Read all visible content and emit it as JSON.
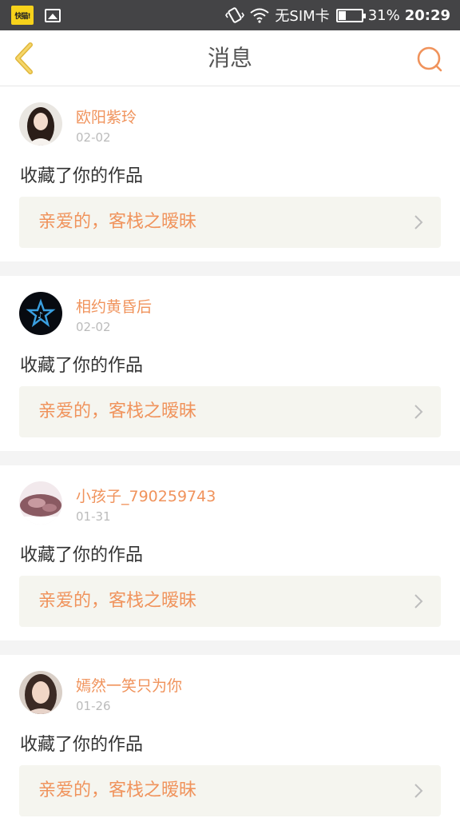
{
  "status_bar": {
    "app_badge": "快猫!",
    "sim_text": "无SIM卡",
    "battery_percent": "31%",
    "battery_level": 0.31,
    "time": "20:29"
  },
  "header": {
    "title": "消息",
    "back_icon": "chevron-left-icon",
    "search_icon": "search-icon"
  },
  "colors": {
    "accent": "#f0935c",
    "back_arrow": "#f5c842",
    "link_bg": "#f5f5ef",
    "divider": "#f4f4f4"
  },
  "messages": [
    {
      "username": "欧阳紫玲",
      "date": "02-02",
      "action": "收藏了你的作品",
      "work_title": "亲爱的，客栈之暧昧"
    },
    {
      "username": "相约黄昏后",
      "date": "02-02",
      "action": "收藏了你的作品",
      "work_title": "亲爱的，客栈之暧昧"
    },
    {
      "username": "小孩子_790259743",
      "date": "01-31",
      "action": "收藏了你的作品",
      "work_title": "亲爱的，客栈之暧昧"
    },
    {
      "username": "嫣然一笑只为你",
      "date": "01-26",
      "action": "收藏了你的作品",
      "work_title": "亲爱的，客栈之暧昧"
    }
  ]
}
